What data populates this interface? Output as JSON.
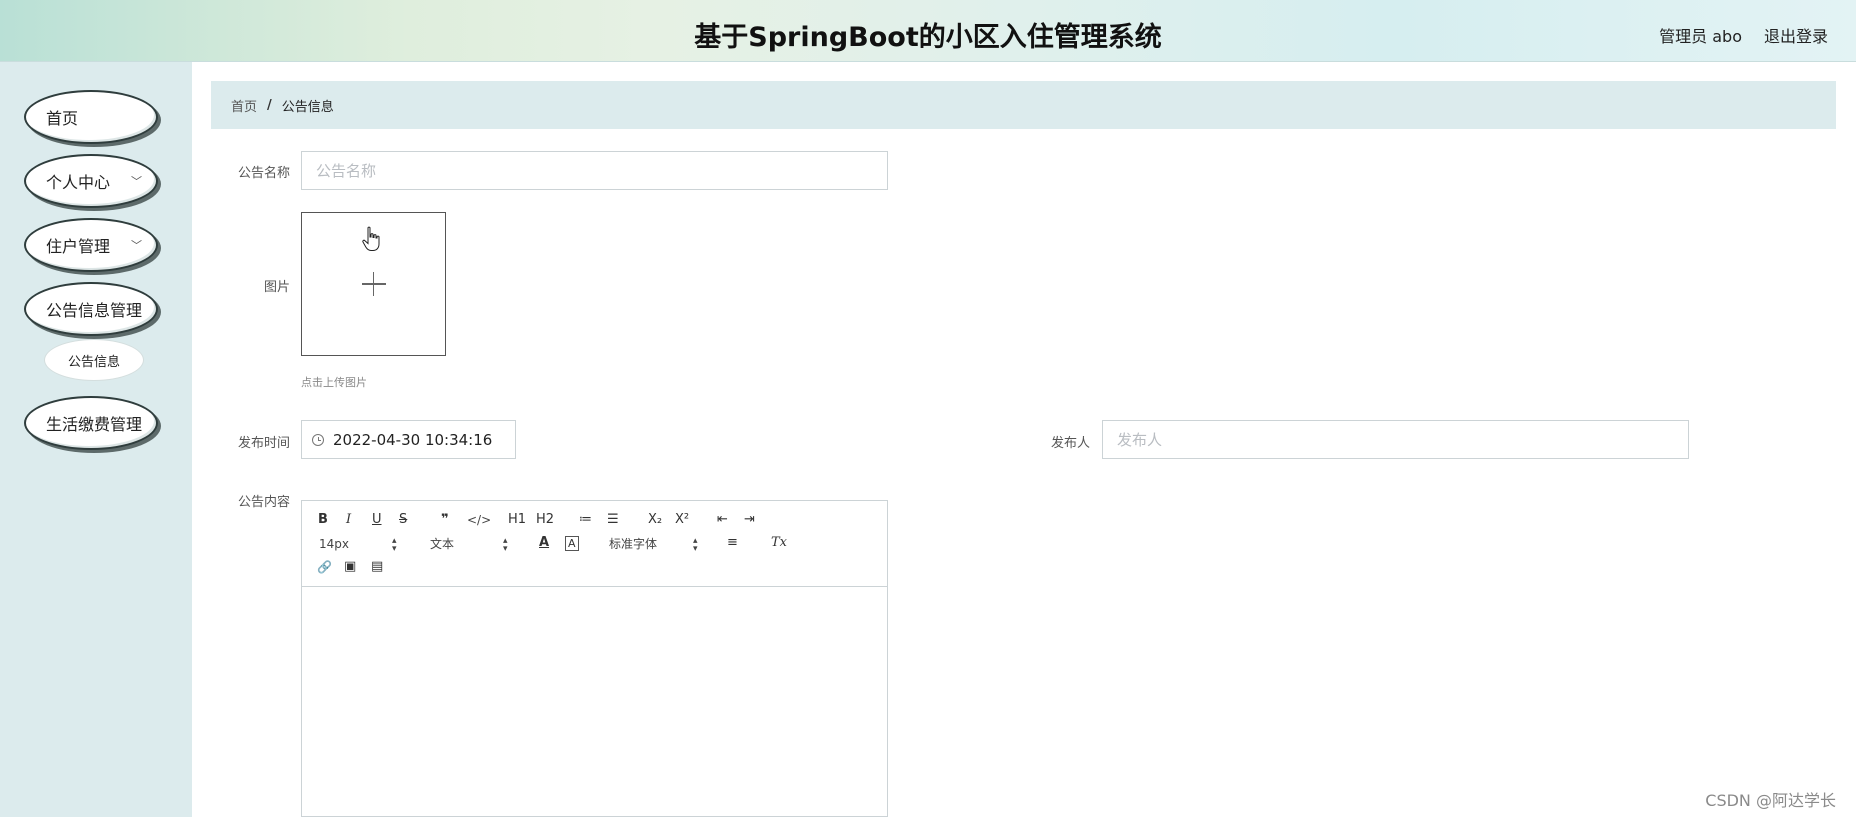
{
  "header": {
    "title": "基于SpringBoot的小区入住管理系统",
    "user": "管理员 abo",
    "logout": "退出登录"
  },
  "sidebar": {
    "items": [
      {
        "label": "首页"
      },
      {
        "label": "个人中心",
        "chevron": "﹀"
      },
      {
        "label": "住户管理",
        "chevron": "﹀"
      },
      {
        "label": "公告信息管理"
      },
      {
        "label": "公告信息",
        "sub": true
      },
      {
        "label": "生活缴费管理"
      }
    ]
  },
  "breadcrumb": {
    "home": "首页",
    "separator": "/",
    "current": "公告信息"
  },
  "form": {
    "name_label": "公告名称",
    "name_placeholder": "公告名称",
    "image_label": "图片",
    "upload_hint": "点击上传图片",
    "time_label": "发布时间",
    "time_value": "2022-04-30 10:34:16",
    "publisher_label": "发布人",
    "publisher_placeholder": "发布人",
    "content_label": "公告内容"
  },
  "editor": {
    "bold": "B",
    "italic": "I",
    "underline": "U",
    "strike": "S",
    "quote": "❞",
    "code": "</>",
    "h1": "H1",
    "h2": "H2",
    "ordered_list": "≔",
    "bullet_list": "☰",
    "sub": "X₂",
    "sup": "X²",
    "outdent": "⇤",
    "indent": "⇥",
    "font_size": "14px",
    "text_type": "文本",
    "font_color": "A",
    "bg_color": "A",
    "font_family": "标准字体",
    "align": "≡",
    "clear_format": "Tx",
    "link": "🔗",
    "image": "▣",
    "video": "▤"
  },
  "watermark": "CSDN @阿达学长"
}
